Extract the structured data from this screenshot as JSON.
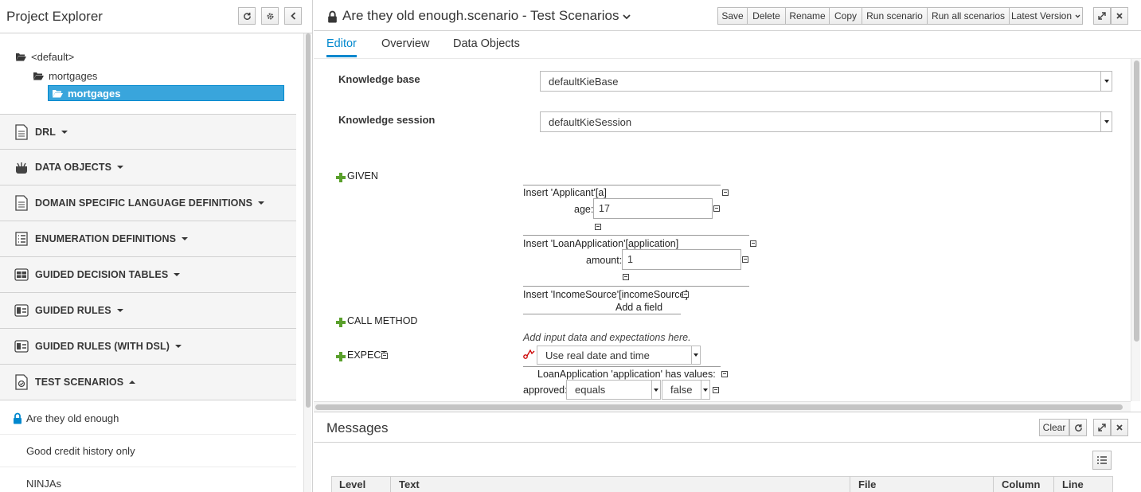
{
  "explorer": {
    "title": "Project Explorer",
    "tree": [
      {
        "label": "<default>"
      },
      {
        "label": "mortgages"
      },
      {
        "label": "mortgages",
        "selected": true
      }
    ],
    "sections": [
      {
        "label": "DRL",
        "icon": "drl-file-icon",
        "expanded": false
      },
      {
        "label": "DATA OBJECTS",
        "icon": "data-object-icon",
        "expanded": false
      },
      {
        "label": "DOMAIN SPECIFIC LANGUAGE DEFINITIONS",
        "icon": "dsl-file-icon",
        "expanded": false
      },
      {
        "label": "ENUMERATION DEFINITIONS",
        "icon": "enumeration-icon",
        "expanded": false
      },
      {
        "label": "GUIDED DECISION TABLES",
        "icon": "decision-table-icon",
        "expanded": false
      },
      {
        "label": "GUIDED RULES",
        "icon": "guided-rule-icon",
        "expanded": false
      },
      {
        "label": "GUIDED RULES (WITH DSL)",
        "icon": "guided-rule-dsl-icon",
        "expanded": false
      },
      {
        "label": "TEST SCENARIOS",
        "icon": "test-scenario-icon",
        "expanded": true
      }
    ],
    "items": [
      {
        "label": "Are they old enough",
        "locked": true
      },
      {
        "label": "Good credit history only",
        "locked": false
      },
      {
        "label": "NINJAs",
        "locked": false
      }
    ]
  },
  "editor": {
    "title": "Are they old enough.scenario - Test Scenarios",
    "toolbar": {
      "save": "Save",
      "delete": "Delete",
      "rename": "Rename",
      "copy": "Copy",
      "run": "Run scenario",
      "run_all": "Run all scenarios",
      "version": "Latest Version"
    },
    "tabs": [
      "Editor",
      "Overview",
      "Data Objects"
    ],
    "active_tab": "Editor",
    "knowledge_base_label": "Knowledge base",
    "knowledge_base_value": "defaultKieBase",
    "knowledge_session_label": "Knowledge session",
    "knowledge_session_value": "defaultKieSession",
    "given_label": "GIVEN",
    "insert1": "Insert 'Applicant'[a]",
    "age_label": "age:",
    "age_value": "17",
    "insert2": "Insert 'LoanApplication'[application]",
    "amount_label": "amount:",
    "amount_value": "1",
    "insert3": "Insert 'IncomeSource'[incomeSource]",
    "add_field": "Add a field",
    "call_method_label": "CALL METHOD",
    "hint": "Add input data and expectations here.",
    "expect_label": "EXPECT",
    "date_option": "Use real date and time",
    "expect_fact": "LoanApplication 'application' has values:",
    "approved_label": "approved:",
    "operator": "equals",
    "approved_value": "false"
  },
  "messages": {
    "title": "Messages",
    "clear": "Clear",
    "columns": [
      "Level",
      "Text",
      "File",
      "Column",
      "Line"
    ]
  },
  "colors": {
    "accent": "#0088ce",
    "selected_bg": "#39a5dc",
    "plus": "#5aa02c"
  }
}
